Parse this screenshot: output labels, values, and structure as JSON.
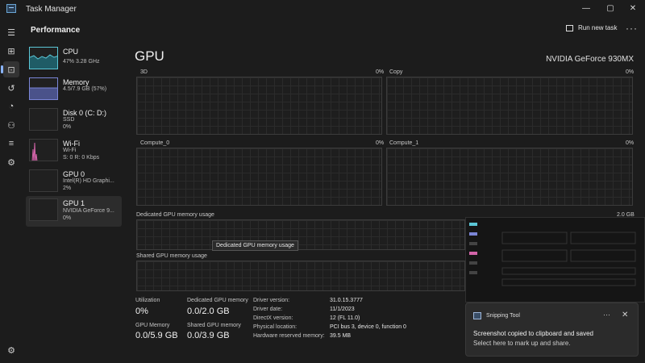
{
  "window": {
    "title": "Task Manager",
    "controls": [
      "—",
      "▢",
      "✕"
    ]
  },
  "header": {
    "section": "Performance",
    "run_new_task": "Run new task",
    "more": "···"
  },
  "sidebar": {
    "items": [
      {
        "name": "CPU",
        "sub": "47%  3.28 GHz"
      },
      {
        "name": "Memory",
        "sub": "4.5/7.9 GB (57%)"
      },
      {
        "name": "Disk 0 (C: D:)",
        "sub1": "SSD",
        "sub2": "0%"
      },
      {
        "name": "Wi-Fi",
        "sub1": "Wi-Fi",
        "sub2": "S: 0  R: 0 Kbps"
      },
      {
        "name": "GPU 0",
        "sub1": "Intel(R) HD Graphi...",
        "sub2": "2%"
      },
      {
        "name": "GPU 1",
        "sub1": "NVIDIA GeForce 9...",
        "sub2": "0%"
      }
    ],
    "colors": {
      "cpu": "#5bc6d6",
      "memory": "#7a85d6",
      "disk": "#7cbf5a",
      "wifi": "#d264a8"
    }
  },
  "main": {
    "title": "GPU",
    "model": "NVIDIA GeForce 930MX",
    "graphs": [
      {
        "label": "3D",
        "pct": "0%"
      },
      {
        "label": "Copy",
        "pct": "0%"
      },
      {
        "label": "Compute_0",
        "pct": "0%"
      },
      {
        "label": "Compute_1",
        "pct": "0%"
      }
    ],
    "dedicated_mem": {
      "label": "Dedicated GPU memory usage",
      "max": "2.0 GB"
    },
    "shared_mem": {
      "label": "Shared GPU memory usage"
    },
    "tooltip": "Dedicated GPU memory usage",
    "stats": {
      "utilization": {
        "label": "Utilization",
        "value": "0%"
      },
      "dedicated": {
        "label": "Dedicated GPU memory",
        "value": "0.0/2.0 GB"
      },
      "gpu_memory": {
        "label": "GPU Memory",
        "value": "0.0/5.9 GB"
      },
      "shared": {
        "label": "Shared GPU memory",
        "value": "0.0/3.9 GB"
      }
    },
    "info": [
      {
        "label": "Driver version:",
        "value": "31.0.15.3777"
      },
      {
        "label": "Driver date:",
        "value": "11/1/2023"
      },
      {
        "label": "DirectX version:",
        "value": "12 (FL 11.0)"
      },
      {
        "label": "Physical location:",
        "value": "PCI bus 3, device 0, function 0"
      },
      {
        "label": "Hardware reserved memory:",
        "value": "39.5 MB"
      }
    ]
  },
  "toast": {
    "app": "Snipping Tool",
    "message": "Screenshot copied to clipboard and saved",
    "sub": "Select here to mark up and share.",
    "more": "···",
    "close": "✕"
  }
}
